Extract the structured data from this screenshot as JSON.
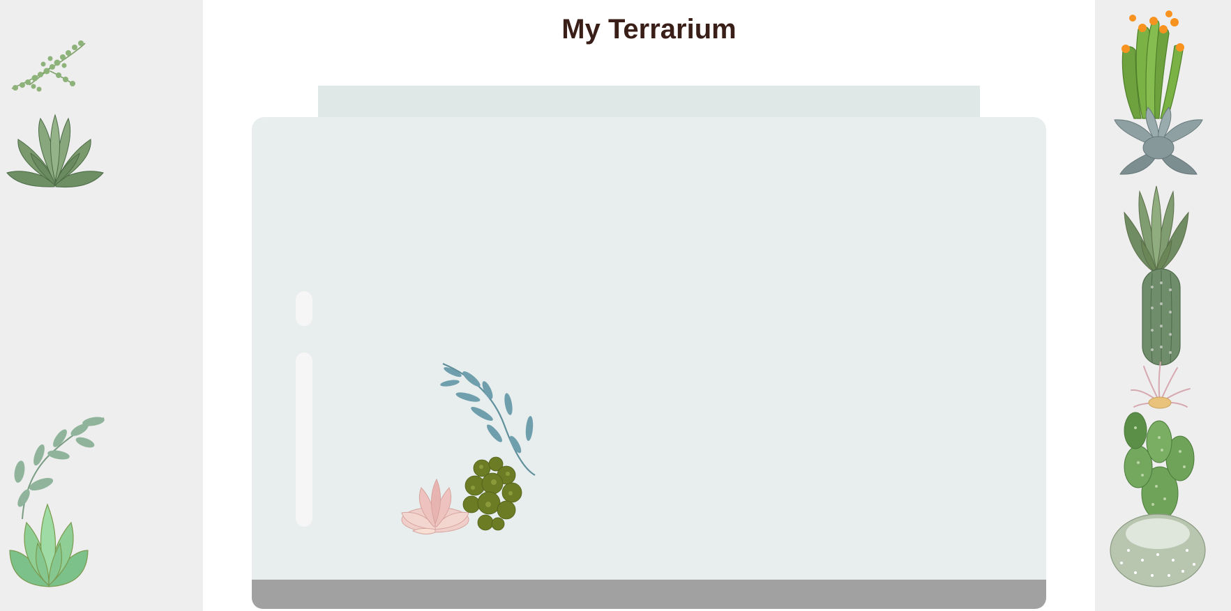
{
  "header": {
    "title": "My Terrarium"
  },
  "containers": {
    "left": {
      "plants": [
        "plant-string-of-pearls",
        "plant-echeveria-green",
        "plant-eucalyptus-sprig",
        "plant-jade-succulent"
      ]
    },
    "right": {
      "plants": [
        "plant-flowering-cactus",
        "plant-blue-echeveria",
        "plant-aloe",
        "plant-column-cactus",
        "plant-air-plant",
        "plant-paddle-cactus",
        "plant-round-cactus"
      ]
    }
  },
  "terrarium": {
    "plants_inside": [
      "plant-eucalyptus-branch",
      "plant-pink-succulent",
      "plant-moss-cluster"
    ]
  },
  "colors": {
    "title": "#3a1f19",
    "side_panel": "#eeeeee",
    "jar_glass": "#e7eeed",
    "jar_top": "#dfe8e7",
    "dirt": "#a1a1a1"
  }
}
